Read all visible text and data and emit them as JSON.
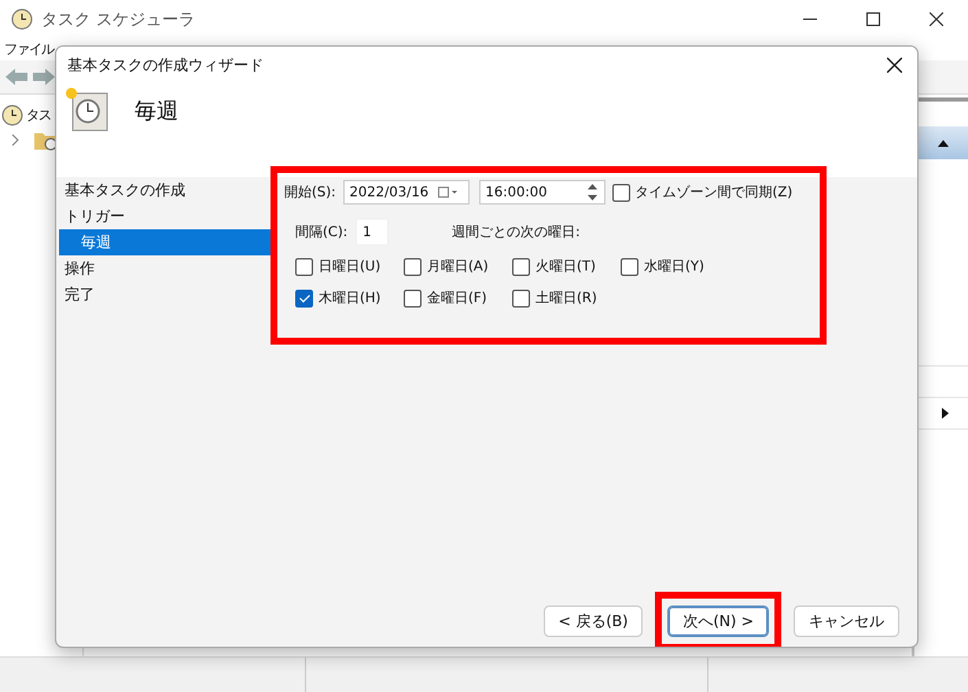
{
  "app": {
    "title": "タスク スケジューラ",
    "menu": [
      "ファイル"
    ],
    "tree": [
      {
        "label": "タス",
        "children": [
          {
            "expanded": false
          }
        ]
      }
    ]
  },
  "dialog": {
    "title": "基本タスクの作成ウィザード",
    "heading": "毎週",
    "steps": [
      {
        "label": "基本タスクの作成",
        "selected": false
      },
      {
        "label": "トリガー",
        "selected": false,
        "children": [
          {
            "label": "毎週",
            "selected": true
          }
        ]
      },
      {
        "label": "操作",
        "selected": false
      },
      {
        "label": "完了",
        "selected": false
      }
    ],
    "form": {
      "annotated": true,
      "start_label": "開始(S):",
      "start_date": "2022/03/16",
      "start_time": "16:00:00",
      "sync": {
        "label": "タイムゾーン間で同期(Z)",
        "checked": false
      },
      "interval_label": "間隔(C):",
      "interval": "1",
      "weekdays_label": "週間ごとの次の曜日:",
      "days": [
        {
          "label": "日曜日(U)",
          "checked": false
        },
        {
          "label": "月曜日(A)",
          "checked": false
        },
        {
          "label": "火曜日(T)",
          "checked": false
        },
        {
          "label": "水曜日(Y)",
          "checked": false
        },
        {
          "label": "木曜日(H)",
          "checked": true
        },
        {
          "label": "金曜日(F)",
          "checked": false
        },
        {
          "label": "土曜日(R)",
          "checked": false
        }
      ]
    },
    "buttons": [
      {
        "label": "< 戻る(B)",
        "default": false,
        "annotated": false
      },
      {
        "label": "次へ(N) >",
        "default": true,
        "annotated": true
      },
      {
        "label": "キャンセル",
        "default": false,
        "annotated": false
      }
    ]
  }
}
